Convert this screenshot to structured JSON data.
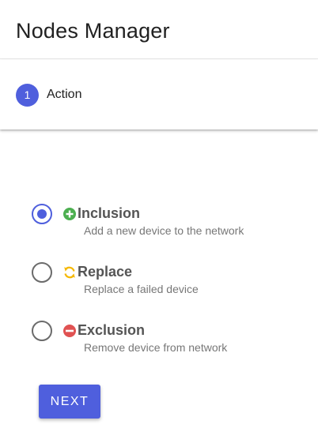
{
  "header": {
    "title": "Nodes Manager"
  },
  "stepper": {
    "step_number": "1",
    "step_label": "Action"
  },
  "options": [
    {
      "label": "Inclusion",
      "description": "Add a new device to the network",
      "icon": "plus-circle-icon",
      "icon_color": "#4caf50",
      "selected": true
    },
    {
      "label": "Replace",
      "description": "Replace a failed device",
      "icon": "refresh-icon",
      "icon_color": "#f5b800",
      "selected": false
    },
    {
      "label": "Exclusion",
      "description": "Remove device from network",
      "icon": "minus-circle-icon",
      "icon_color": "#e05252",
      "selected": false
    }
  ],
  "actions": {
    "next_label": "NEXT"
  },
  "colors": {
    "accent": "#4f5fdd",
    "title_text": "#212121",
    "option_label": "#555555",
    "option_description": "#777777"
  }
}
